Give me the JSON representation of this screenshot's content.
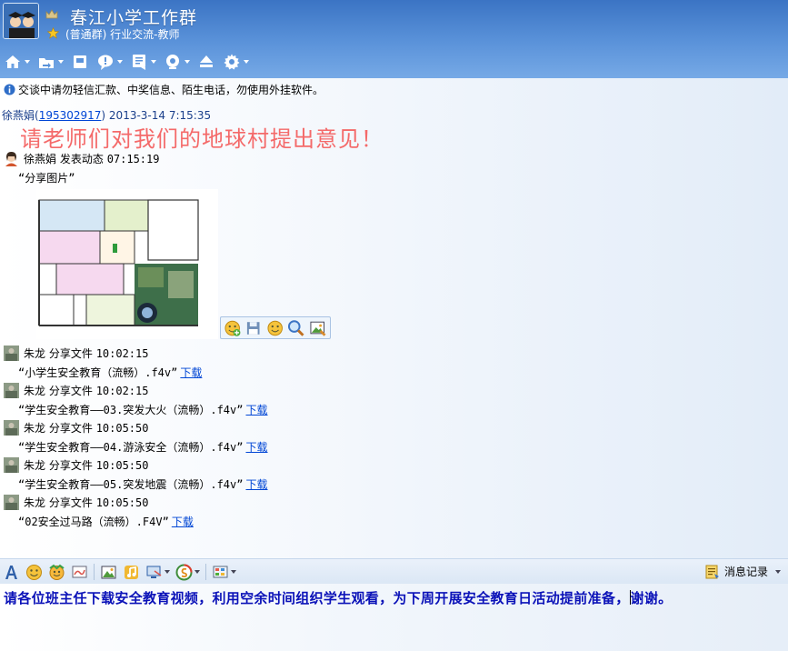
{
  "header": {
    "title": "春江小学工作群",
    "subtitle": "(普通群) 行业交流-教师"
  },
  "notice": "交谈中请勿轻信汇款、中奖信息、陌生电话，勿使用外挂软件。",
  "message": {
    "sender": "徐燕娟",
    "qq": "195302917",
    "timestamp": "2013-3-14 7:15:35",
    "text": "请老师们对我们的地球村提出意见！"
  },
  "feed": [
    {
      "who": "徐燕娟",
      "action": "发表动态",
      "time": "07:15:19",
      "body": "“分享图片”",
      "link": ""
    },
    {
      "who": "朱龙",
      "action": "分享文件",
      "time": "10:02:15",
      "body": "“小学生安全教育（流畅）.f4v”",
      "link": "下载"
    },
    {
      "who": "朱龙",
      "action": "分享文件",
      "time": "10:02:15",
      "body": "“学生安全教育——03.突发大火（流畅）.f4v”",
      "link": "下载"
    },
    {
      "who": "朱龙",
      "action": "分享文件",
      "time": "10:05:50",
      "body": "“学生安全教育——04.游泳安全（流畅）.f4v”",
      "link": "下载"
    },
    {
      "who": "朱龙",
      "action": "分享文件",
      "time": "10:05:50",
      "body": "“学生安全教育——05.突发地震（流畅）.f4v”",
      "link": "下载"
    },
    {
      "who": "朱龙",
      "action": "分享文件",
      "time": "10:05:50",
      "body": "“02安全过马路（流畅）.F4V”",
      "link": "下载"
    }
  ],
  "input_toolbar": {
    "history_label": "消息记录"
  },
  "compose": {
    "text_before_caret": "请各位班主任下载安全教育视频，利用空余时间组织学生观看，为下周开展安全教育日活动提前准备，",
    "text_after_caret": "谢谢。"
  },
  "colors": {
    "header_top": "#3b74c4",
    "header_bottom": "#76a9e6",
    "big_message": "#f46a6a",
    "compose_text": "#0b12b8",
    "link": "#0046d5"
  }
}
